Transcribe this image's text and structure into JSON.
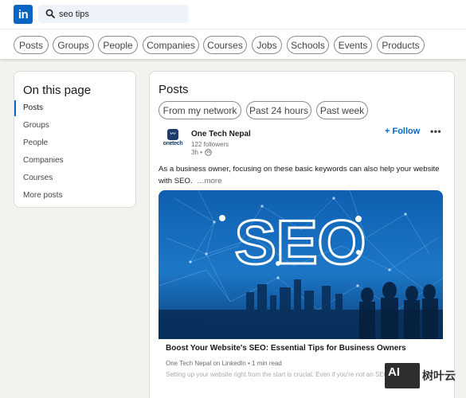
{
  "header": {
    "logo_text": "in",
    "search": {
      "value": "seo tips",
      "placeholder": ""
    }
  },
  "filters": [
    "Posts",
    "Groups",
    "People",
    "Companies",
    "Courses",
    "Jobs",
    "Schools",
    "Events",
    "Products"
  ],
  "sidebar": {
    "title": "On this page",
    "items": [
      {
        "label": "Posts",
        "active": true
      },
      {
        "label": "Groups"
      },
      {
        "label": "People"
      },
      {
        "label": "Companies"
      },
      {
        "label": "Courses"
      },
      {
        "label": "More posts"
      }
    ]
  },
  "main": {
    "title": "Posts",
    "sub_filters": [
      "From my network",
      "Past 24 hours",
      "Past week"
    ],
    "post": {
      "company_logo_text": "onetech",
      "author": "One Tech Nepal",
      "followers": "122 followers",
      "time": "3h •",
      "follow_label": "+ Follow",
      "more_label": "•••",
      "text": "As a business owner, focusing on these basic keywords can also help your website with SEO.",
      "see_more": "…more",
      "article": {
        "image_text": "SEO",
        "title": "Boost Your Website's SEO: Essential Tips for Business Owners",
        "source": "One Tech Nepal on LinkedIn • 1 min read",
        "snippet": "Setting up your website right from the start is crucial. Even if you're not an SEO"
      }
    }
  },
  "watermark": {
    "badge": "AI",
    "text": "树叶云"
  },
  "colors": {
    "brand": "#0a66c2",
    "background": "#f4f2ee"
  }
}
